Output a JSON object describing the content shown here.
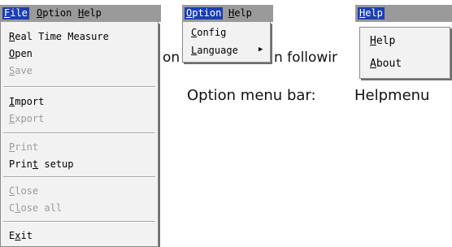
{
  "file_menu": {
    "bar_items": [
      {
        "label": "File",
        "mnemonic": "F",
        "rest": "ile"
      },
      {
        "label": "Option",
        "mnemonic": "O",
        "rest": "ption"
      },
      {
        "label": "Help",
        "mnemonic": "H",
        "rest": "elp"
      }
    ],
    "items": [
      {
        "pre": "",
        "mn": "R",
        "post": "eal Time Measure",
        "enabled": true
      },
      {
        "pre": "",
        "mn": "O",
        "post": "pen",
        "enabled": true
      },
      {
        "pre": "",
        "mn": "S",
        "post": "ave",
        "enabled": false
      },
      {
        "pre": "",
        "mn": "I",
        "post": "mport",
        "enabled": true
      },
      {
        "pre": "",
        "mn": "E",
        "post": "xport",
        "enabled": false
      },
      {
        "pre": "",
        "mn": "P",
        "post": "rint",
        "enabled": false
      },
      {
        "pre": "Prin",
        "mn": "t",
        "post": " setup",
        "enabled": true
      },
      {
        "pre": "",
        "mn": "C",
        "post": "lose",
        "enabled": false
      },
      {
        "pre": "C",
        "mn": "l",
        "post": "ose all",
        "enabled": false
      },
      {
        "pre": "E",
        "mn": "x",
        "post": "it",
        "enabled": true
      }
    ]
  },
  "option_menu": {
    "bar_items": [
      {
        "mnemonic": "O",
        "rest": "ption"
      },
      {
        "mnemonic": "H",
        "rest": "elp"
      }
    ],
    "items": [
      {
        "mn": "C",
        "post": "onfig"
      },
      {
        "mn": "L",
        "post": "anguage"
      }
    ],
    "submenu_arrow": "▶"
  },
  "help_menu": {
    "bar_items": [
      {
        "mnemonic": "H",
        "rest": "elp"
      }
    ],
    "items": [
      {
        "mn": "H",
        "post": "elp"
      },
      {
        "mn": "A",
        "post": "bout"
      }
    ]
  },
  "background_text": {
    "fragment_1": "on",
    "fragment_2": "n followir",
    "caption_option": "Option menu bar:",
    "caption_help": "Helpmenu"
  }
}
